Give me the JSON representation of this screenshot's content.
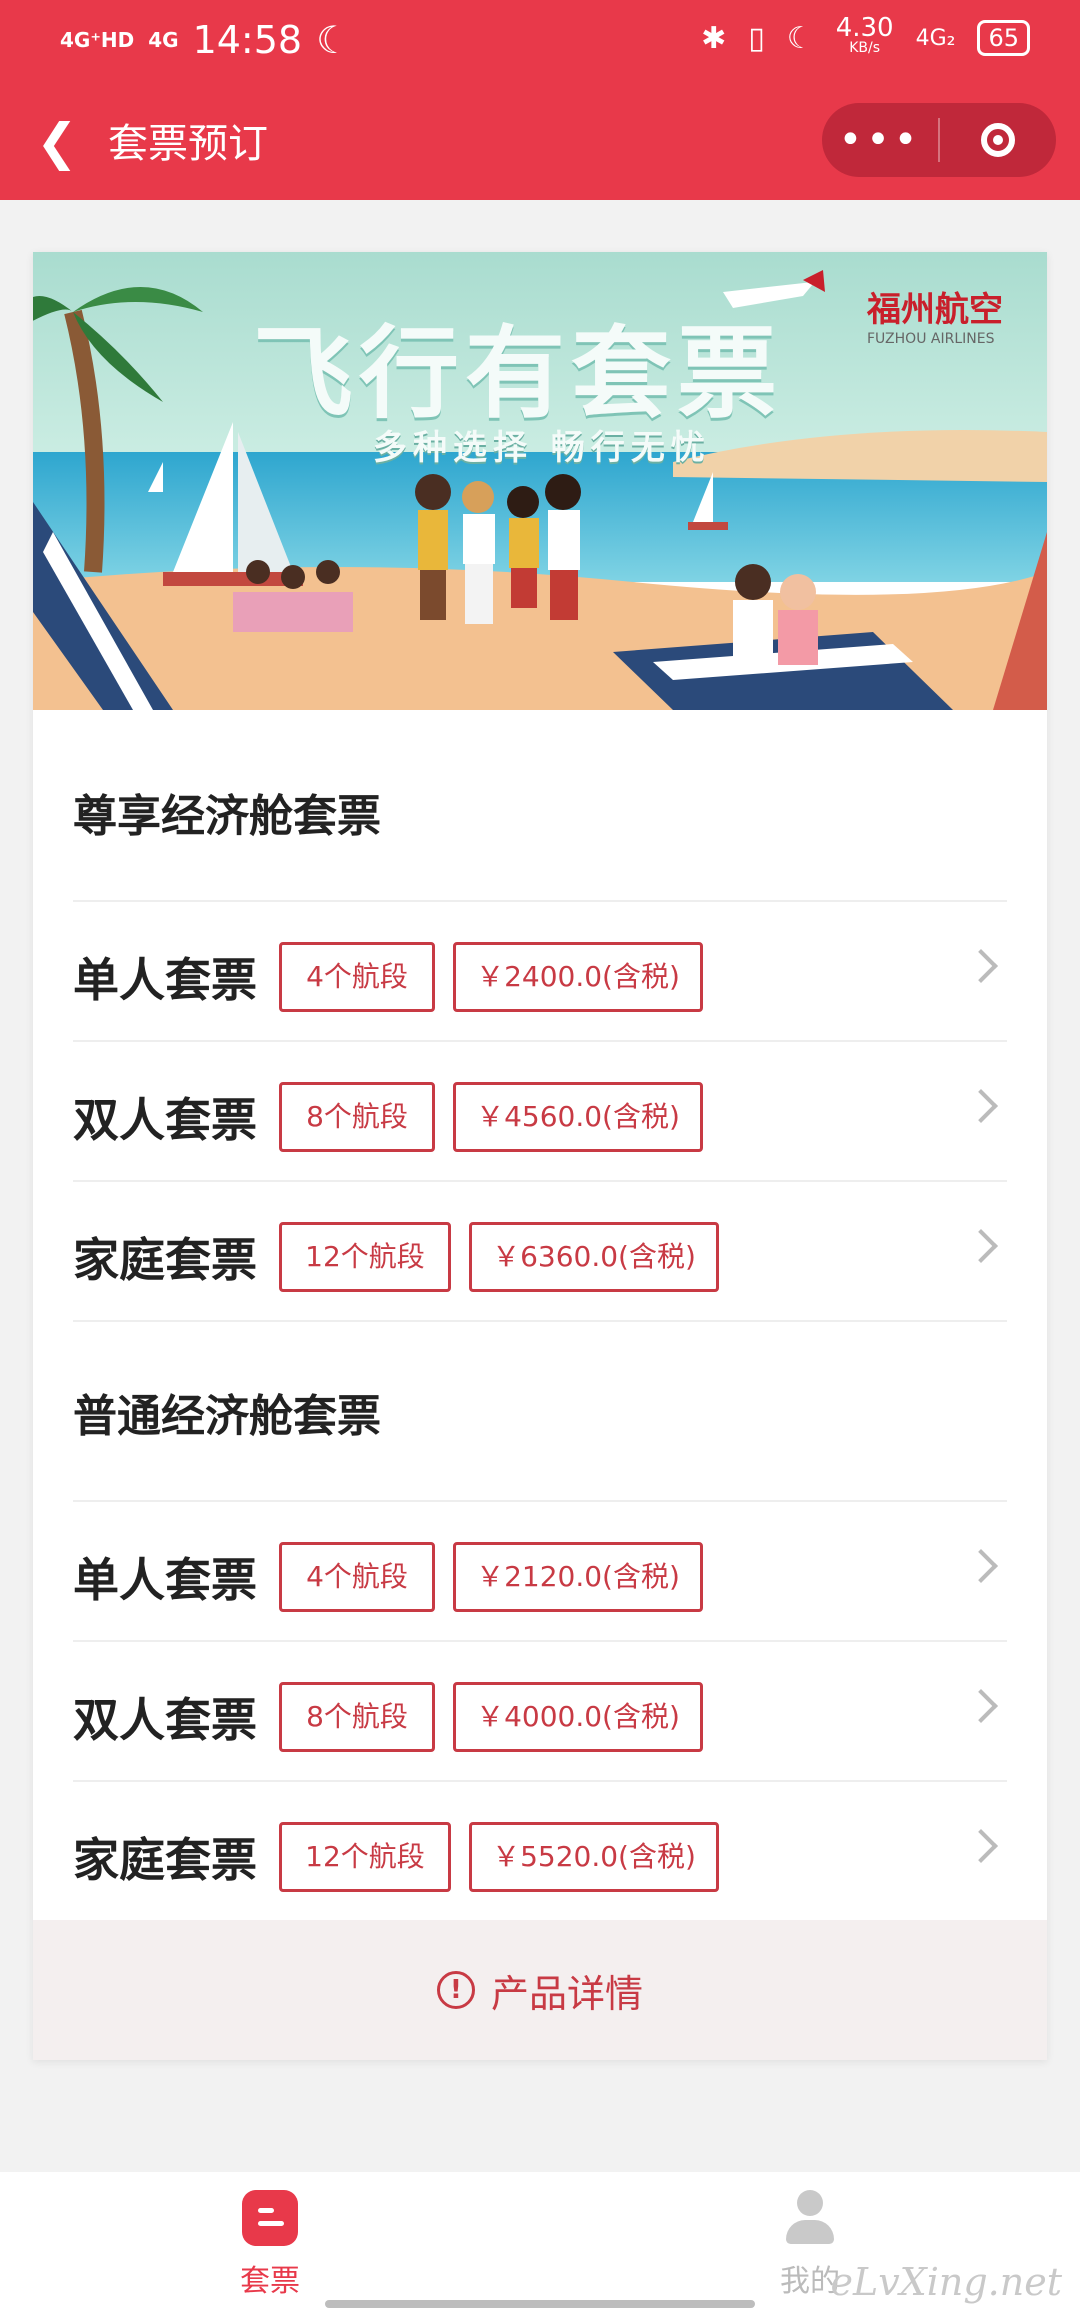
{
  "status_bar": {
    "network1": "4G⁺HD",
    "network2": "4G",
    "time": "14:58",
    "speed": "4.30",
    "speed_unit": "KB/s",
    "network3": "4G₂",
    "battery": "65"
  },
  "nav": {
    "title": "套票预订",
    "more_icon": "more-dots-icon",
    "target_icon": "target-icon"
  },
  "banner": {
    "headline": "飞行有套票",
    "subline": "多种选择 畅行无忧",
    "logo_cn": "福州航空",
    "logo_en": "FUZHOU AIRLINES"
  },
  "sections": [
    {
      "title": "尊享经济舱套票",
      "rows": [
        {
          "name": "单人套票",
          "segments": "4个航段",
          "price": "￥2400.0(含税)"
        },
        {
          "name": "双人套票",
          "segments": "8个航段",
          "price": "￥4560.0(含税)"
        },
        {
          "name": "家庭套票",
          "segments": "12个航段",
          "price": "￥6360.0(含税)"
        }
      ]
    },
    {
      "title": "普通经济舱套票",
      "rows": [
        {
          "name": "单人套票",
          "segments": "4个航段",
          "price": "￥2120.0(含税)"
        },
        {
          "name": "双人套票",
          "segments": "8个航段",
          "price": "￥4000.0(含税)"
        },
        {
          "name": "家庭套票",
          "segments": "12个航段",
          "price": "￥5520.0(含税)"
        }
      ]
    }
  ],
  "details": {
    "label": "产品详情"
  },
  "tabbar": {
    "tabs": [
      {
        "label": "套票",
        "icon": "ticket-icon",
        "active": true
      },
      {
        "label": "我的",
        "icon": "person-icon",
        "active": false
      }
    ]
  },
  "watermark": "eLvXing.net",
  "colors": {
    "primary": "#e8394a",
    "accent": "#c83a44"
  }
}
